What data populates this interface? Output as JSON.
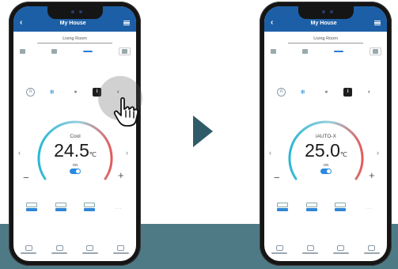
{
  "colors": {
    "band": "#4e7a86",
    "app_bar": "#1d5fa6",
    "arrow": "#2f5b68",
    "dial_cool": "#2ab7d4",
    "dial_warm": "#e35a5a",
    "toggle": "#2a8ae0"
  },
  "left_phone": {
    "header": {
      "title": "My House",
      "back_icon": "chevron-left-icon",
      "menu_icon": "hamburger-menu-icon"
    },
    "room": "Living Room",
    "mode_icons": [
      "auto-icon",
      "cool-snowflake-icon",
      "dry-drop-icon",
      "heat-icon",
      "fan-icon"
    ],
    "selected_mode": "heat-icon",
    "mode_label": "Cool",
    "temperature": "24.5",
    "unit": "℃",
    "power_label": "ON",
    "tapping": true
  },
  "right_phone": {
    "header": {
      "title": "My House",
      "back_icon": "chevron-left-icon",
      "menu_icon": "hamburger-menu-icon"
    },
    "room": "Living Room",
    "mode_icons": [
      "auto-icon",
      "cool-snowflake-icon",
      "dry-drop-icon",
      "heat-icon",
      "fan-icon"
    ],
    "selected_mode": "heat-icon",
    "mode_label": "iAUTO-X",
    "temperature": "25.0",
    "unit": "℃",
    "power_label": "ON"
  },
  "controls": {
    "minus": "−",
    "plus": "+",
    "prev": "‹",
    "next": "›"
  }
}
